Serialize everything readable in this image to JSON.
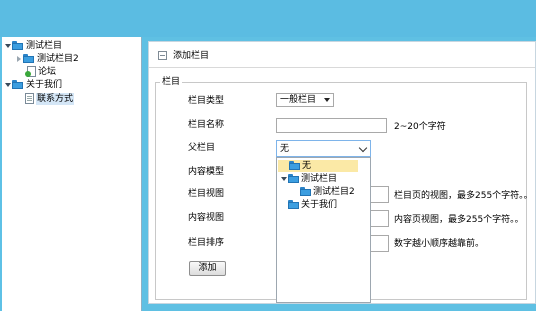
{
  "sidebar": {
    "tree": [
      {
        "label": "测试栏目",
        "icon": "folder-icon",
        "expanded": true
      },
      {
        "label": "测试栏目2",
        "icon": "folder-icon",
        "expanded": false
      },
      {
        "label": "论坛",
        "icon": "page-icon"
      },
      {
        "label": "关于我们",
        "icon": "folder-icon",
        "expanded": true
      },
      {
        "label": "联系方式",
        "icon": "page-icon"
      }
    ]
  },
  "page": {
    "title": "添加栏目",
    "section_legend": "栏目"
  },
  "form": {
    "type_label": "栏目类型",
    "type_value": "一般栏目",
    "name_label": "栏目名称",
    "name_hint": "2~20个字符",
    "parent_label": "父栏目",
    "parent_value": "无",
    "model_label": "内容模型",
    "view_label": "栏目视图",
    "view_hint": "栏目页的视图，最多255个字符。。",
    "content_view_label": "内容视图",
    "content_view_hint": "内容页视图，最多255个字符。。",
    "sort_label": "栏目排序",
    "sort_hint": "数字越小顺序越靠前。",
    "submit_label": "添加"
  },
  "parent_dropdown": {
    "options": [
      {
        "label": "无",
        "icon": "folder-icon",
        "highlighted": true
      },
      {
        "label": "测试栏目",
        "icon": "folder-icon",
        "expanded": true
      },
      {
        "label": "测试栏目2",
        "icon": "folder-icon"
      },
      {
        "label": "关于我们",
        "icon": "folder-icon"
      }
    ]
  },
  "colors": {
    "background": "#5fc0e3",
    "highlight": "#fbe9a6",
    "focus_border": "#7eb4ea"
  }
}
